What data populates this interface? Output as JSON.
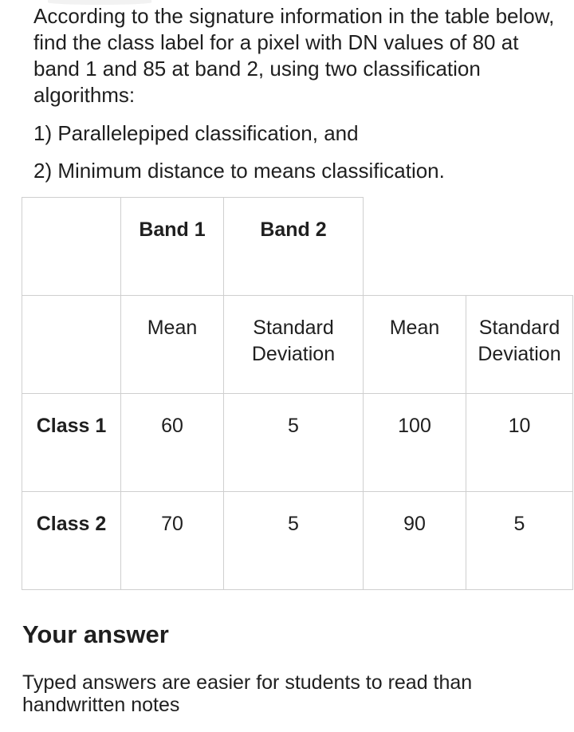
{
  "question": {
    "text": "According to the signature information in the table below, find the class label for a pixel with DN values of 80 at band 1 and 85 at band 2, using two classification algorithms:",
    "options": [
      "1) Parallelepiped classification, and",
      "2) Minimum distance to means classification."
    ]
  },
  "table": {
    "header": [
      "",
      "Band 1",
      "Band 2"
    ],
    "subheader": [
      "",
      "Mean",
      "Standard Deviation",
      "Mean",
      "Standard Deviation"
    ],
    "rows": [
      [
        "Class 1",
        "60",
        "5",
        "100",
        "10"
      ],
      [
        "Class 2",
        "70",
        "5",
        "90",
        "5"
      ]
    ]
  },
  "answer": {
    "heading": "Your answer",
    "hint": "Typed answers are easier for students to read than handwritten notes"
  }
}
